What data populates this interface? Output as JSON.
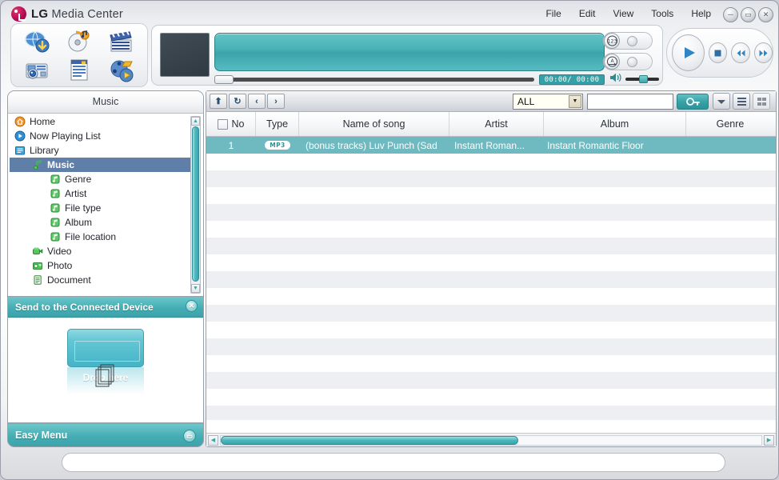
{
  "window": {
    "brand": "LG",
    "title": "Media Center",
    "controls": [
      {
        "name": "minimize",
        "glyph": "─"
      },
      {
        "name": "maximize",
        "glyph": "▭"
      },
      {
        "name": "close",
        "glyph": "✕"
      }
    ]
  },
  "menu": {
    "items": [
      {
        "label": "File"
      },
      {
        "label": "Edit"
      },
      {
        "label": "View"
      },
      {
        "label": "Tools"
      },
      {
        "label": "Help"
      }
    ]
  },
  "toolbar_icons": [
    {
      "name": "internet-download-icon"
    },
    {
      "name": "music-cd-icon"
    },
    {
      "name": "movie-clapper-icon"
    },
    {
      "name": "camera-photo-icon"
    },
    {
      "name": "document-icon"
    },
    {
      "name": "media-play-icon"
    }
  ],
  "player": {
    "time_display": "00:00/ 00:00",
    "seek_position_percent": 0,
    "volume_percent": 55,
    "shuffle_label": "1 2 3",
    "repeat_label": "A",
    "transport": [
      {
        "name": "play-button",
        "label": "Play"
      },
      {
        "name": "stop-button",
        "label": "Stop"
      },
      {
        "name": "previous-button",
        "label": "Previous"
      },
      {
        "name": "next-button",
        "label": "Next"
      }
    ]
  },
  "sidebar": {
    "header": "Music",
    "tree": [
      {
        "label": "Home",
        "level": 0,
        "icon": "home-icon",
        "selected": false
      },
      {
        "label": "Now Playing List",
        "level": 0,
        "icon": "play-circle-icon",
        "selected": false
      },
      {
        "label": "Library",
        "level": 0,
        "icon": "library-folder-icon",
        "selected": false
      },
      {
        "label": "Music",
        "level": 1,
        "icon": "music-note-icon",
        "selected": true
      },
      {
        "label": "Genre",
        "level": 2,
        "icon": "note-tag-icon",
        "selected": false
      },
      {
        "label": "Artist",
        "level": 2,
        "icon": "note-tag-icon",
        "selected": false
      },
      {
        "label": "File type",
        "level": 2,
        "icon": "note-tag-icon",
        "selected": false
      },
      {
        "label": "Album",
        "level": 2,
        "icon": "note-tag-icon",
        "selected": false
      },
      {
        "label": "File location",
        "level": 2,
        "icon": "note-tag-icon",
        "selected": false
      },
      {
        "label": "Video",
        "level": 1,
        "icon": "video-camera-icon",
        "selected": false
      },
      {
        "label": "Photo",
        "level": 1,
        "icon": "photo-icon",
        "selected": false
      },
      {
        "label": "Document",
        "level": 1,
        "icon": "document-page-icon",
        "selected": false
      }
    ],
    "device_panel": {
      "title": "Send to the Connected Device",
      "drop_label": "Drop here"
    },
    "easy_menu": {
      "label": "Easy Menu"
    }
  },
  "content": {
    "nav_buttons": [
      {
        "name": "up-button",
        "glyph": "⬆"
      },
      {
        "name": "refresh-button",
        "glyph": "↻"
      },
      {
        "name": "back-button",
        "glyph": "‹"
      },
      {
        "name": "forward-button",
        "glyph": "›"
      }
    ],
    "filter": {
      "selected": "ALL"
    },
    "search": {
      "value": "",
      "placeholder": ""
    },
    "view_buttons": [
      {
        "name": "view-dropdown-button"
      },
      {
        "name": "list-view-button"
      },
      {
        "name": "thumbnail-view-button"
      }
    ],
    "columns": [
      {
        "key": "no",
        "label": "No"
      },
      {
        "key": "type",
        "label": "Type"
      },
      {
        "key": "song",
        "label": "Name of song"
      },
      {
        "key": "artist",
        "label": "Artist"
      },
      {
        "key": "album",
        "label": "Album"
      },
      {
        "key": "genre",
        "label": "Genre"
      }
    ],
    "rows": [
      {
        "no": "1",
        "type": "MP3",
        "song": "(bonus tracks) Luv Punch (Sad",
        "artist": "Instant Roman...",
        "album": "Instant Romantic Floor",
        "genre": "",
        "selected": true
      }
    ],
    "empty_row_count": 16,
    "hscroll_thumb_percent": 55
  },
  "status": {
    "text": ""
  },
  "colors": {
    "accent_teal": "#3ba3a9",
    "selection_blue": "#5f7fa8",
    "row_selected": "#6fbac0",
    "brand_red": "#a6004a"
  }
}
